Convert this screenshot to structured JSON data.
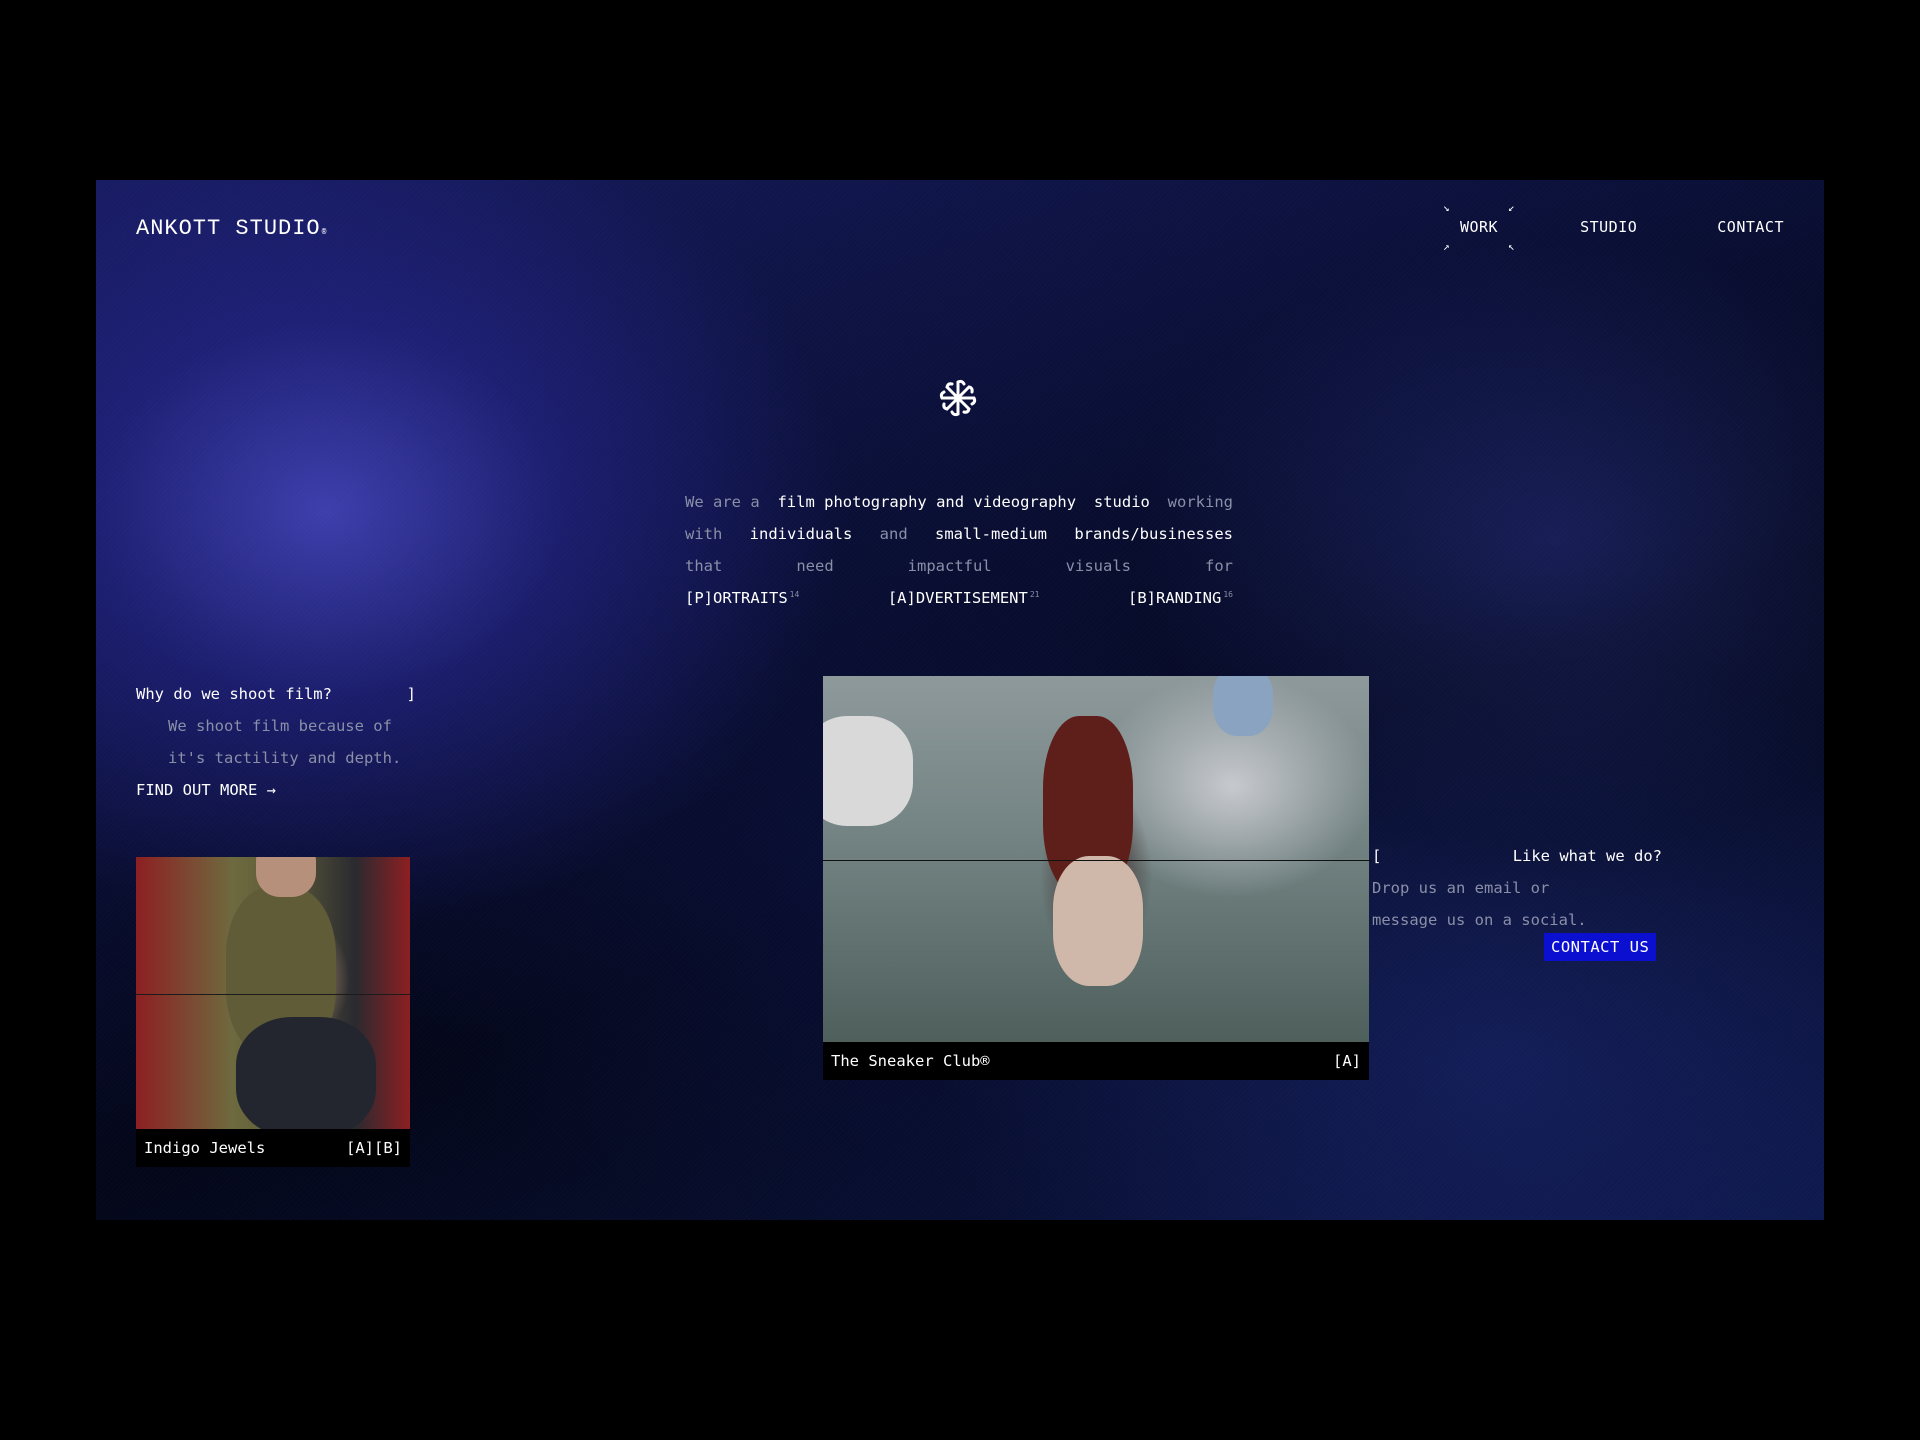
{
  "header": {
    "logo": "ANKOTT STUDIO",
    "logo_mark": "®",
    "nav": [
      {
        "label": "WORK",
        "active": true
      },
      {
        "label": "STUDIO",
        "active": false
      },
      {
        "label": "CONTACT",
        "active": false
      }
    ],
    "corner_glyphs": [
      "↘",
      "↙",
      "↗",
      "↖"
    ]
  },
  "hero": {
    "icon": "asterisk-pinwheel-icon",
    "lines": [
      [
        {
          "text": "We are a",
          "style": "dim"
        },
        {
          "text": "film photography and videography",
          "style": "bright"
        },
        {
          "text": "studio",
          "style": "bright"
        },
        {
          "text": "working",
          "style": "dim"
        }
      ],
      [
        {
          "text": "with",
          "style": "dim"
        },
        {
          "text": "individuals",
          "style": "bright"
        },
        {
          "text": "and",
          "style": "dim"
        },
        {
          "text": "small-medium",
          "style": "bright"
        },
        {
          "text": "brands/businesses",
          "style": "bright"
        }
      ],
      [
        {
          "text": "that",
          "style": "dim"
        },
        {
          "text": "need",
          "style": "dim"
        },
        {
          "text": "impactful",
          "style": "dim"
        },
        {
          "text": "visuals",
          "style": "dim"
        },
        {
          "text": "for",
          "style": "dim"
        }
      ]
    ],
    "categories": [
      {
        "label": "[P]ORTRAITS",
        "count": "14"
      },
      {
        "label": "[A]DVERTISEMENT",
        "count": "21"
      },
      {
        "label": "[B]RANDING",
        "count": "16"
      }
    ]
  },
  "film": {
    "question": "Why do we shoot film?",
    "bracket": "]",
    "answer_lines": [
      "We shoot film  because  of",
      "it's tactility and depth."
    ],
    "link": "FIND OUT MORE →"
  },
  "projects": [
    {
      "title": "Indigo Jewels",
      "tags": "[A][B]"
    },
    {
      "title": "The Sneaker Club®",
      "tags": "[A]"
    }
  ],
  "contact": {
    "bracket": "[",
    "question": "Like what we do?",
    "answer_lines": [
      "Drop  us  an   email   or",
      "message us  on  a social."
    ],
    "button": "CONTACT US"
  },
  "colors": {
    "accent": "#0a0fd0",
    "background_glow": "#3a3fb8",
    "dim_text": "#8a8fa8"
  }
}
